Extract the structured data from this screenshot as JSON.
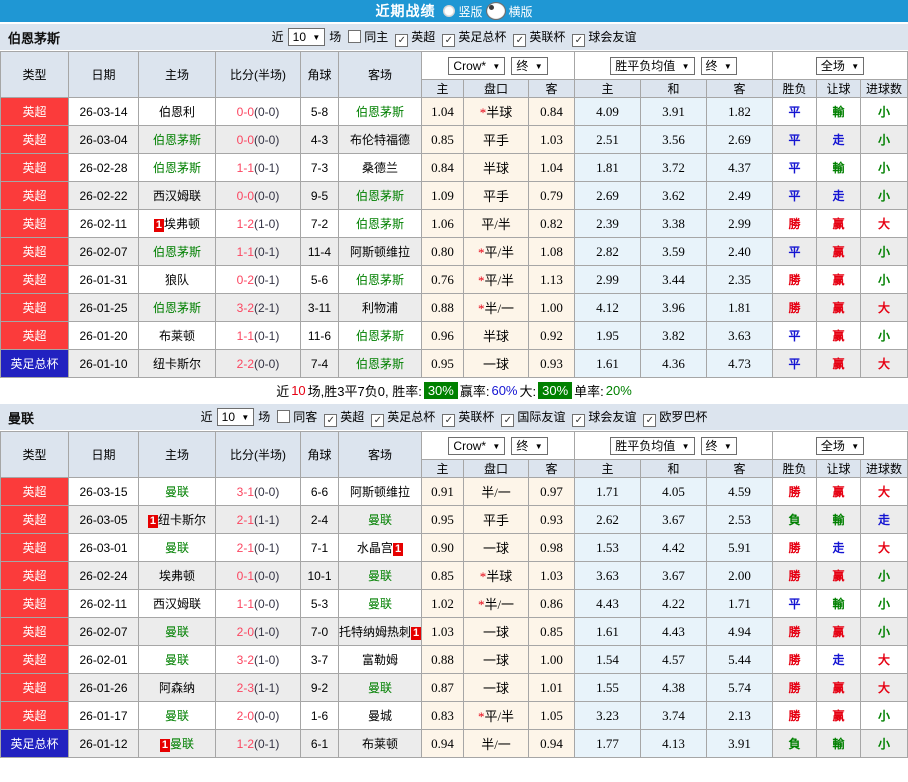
{
  "colors": {
    "topbar_blue": "#1f97d4",
    "header_gray": "#dce4ee",
    "league_red": "#fb3b3b",
    "cup_blue": "#2121c0",
    "win": "#e60012",
    "draw": "#1414d2",
    "lose": "#008000",
    "team_green": "#008000",
    "score_red": "#fb4560",
    "badge_red": "#e60000",
    "summary_box_green": "#008000",
    "crow_col_bg": "#fdf5e9",
    "avg_col_bg": "#e8f3fa"
  },
  "topbar": {
    "title": "近期战绩",
    "vertical_label": "竖版",
    "horizontal_label": "横版",
    "selected": "横版"
  },
  "table_header": {
    "main_cols": [
      "类型",
      "日期",
      "主场",
      "比分(半场)",
      "角球",
      "客场"
    ],
    "crow_select": "Crow*",
    "end_select_1": "终",
    "avg_select": "胜平负均值",
    "end_select_2": "终",
    "full_select": "全场",
    "sub_cols": [
      "主",
      "盘口",
      "客",
      "主",
      "和",
      "客",
      "胜负",
      "让球",
      "进球数"
    ]
  },
  "sections": [
    {
      "team": "伯恩茅斯",
      "filters": {
        "near": "近",
        "count": "10",
        "unit": "场",
        "same": "同主",
        "same_checked": false,
        "leagues": [
          "英超",
          "英足总杯",
          "英联杯",
          "球会友谊"
        ]
      },
      "rows": [
        {
          "league": "英超",
          "league_color": "red",
          "date": "26-03-14",
          "home": "伯恩利",
          "home_green": false,
          "home_badge": "",
          "score": "0-0",
          "half": "(0-0)",
          "corners": "5-8",
          "away": "伯恩茅斯",
          "away_green": true,
          "away_badge": "",
          "crow_home": "1.04",
          "handicap": "*半球",
          "crow_away": "0.84",
          "avg_home": "4.09",
          "avg_draw": "3.91",
          "avg_away": "1.82",
          "result": "平",
          "handicap_result": "輸",
          "goals_result": "小"
        },
        {
          "league": "英超",
          "league_color": "red",
          "date": "26-03-04",
          "home": "伯恩茅斯",
          "home_green": true,
          "home_badge": "",
          "score": "0-0",
          "half": "(0-0)",
          "corners": "4-3",
          "away": "布伦特福德",
          "away_green": false,
          "away_badge": "",
          "crow_home": "0.85",
          "handicap": "平手",
          "crow_away": "1.03",
          "avg_home": "2.51",
          "avg_draw": "3.56",
          "avg_away": "2.69",
          "result": "平",
          "handicap_result": "走",
          "goals_result": "小"
        },
        {
          "league": "英超",
          "league_color": "red",
          "date": "26-02-28",
          "home": "伯恩茅斯",
          "home_green": true,
          "home_badge": "",
          "score": "1-1",
          "half": "(0-1)",
          "corners": "7-3",
          "away": "桑德兰",
          "away_green": false,
          "away_badge": "",
          "crow_home": "0.84",
          "handicap": "半球",
          "crow_away": "1.04",
          "avg_home": "1.81",
          "avg_draw": "3.72",
          "avg_away": "4.37",
          "result": "平",
          "handicap_result": "輸",
          "goals_result": "小"
        },
        {
          "league": "英超",
          "league_color": "red",
          "date": "26-02-22",
          "home": "西汉姆联",
          "home_green": false,
          "home_badge": "",
          "score": "0-0",
          "half": "(0-0)",
          "corners": "9-5",
          "away": "伯恩茅斯",
          "away_green": true,
          "away_badge": "",
          "crow_home": "1.09",
          "handicap": "平手",
          "crow_away": "0.79",
          "avg_home": "2.69",
          "avg_draw": "3.62",
          "avg_away": "2.49",
          "result": "平",
          "handicap_result": "走",
          "goals_result": "小"
        },
        {
          "league": "英超",
          "league_color": "red",
          "date": "26-02-11",
          "home": "埃弗顿",
          "home_green": false,
          "home_badge": "1",
          "score": "1-2",
          "half": "(1-0)",
          "corners": "7-2",
          "away": "伯恩茅斯",
          "away_green": true,
          "away_badge": "",
          "crow_home": "1.06",
          "handicap": "平/半",
          "crow_away": "0.82",
          "avg_home": "2.39",
          "avg_draw": "3.38",
          "avg_away": "2.99",
          "result": "勝",
          "handicap_result": "赢",
          "goals_result": "大"
        },
        {
          "league": "英超",
          "league_color": "red",
          "date": "26-02-07",
          "home": "伯恩茅斯",
          "home_green": true,
          "home_badge": "",
          "score": "1-1",
          "half": "(0-1)",
          "corners": "11-4",
          "away": "阿斯顿维拉",
          "away_green": false,
          "away_badge": "",
          "crow_home": "0.80",
          "handicap": "*平/半",
          "crow_away": "1.08",
          "avg_home": "2.82",
          "avg_draw": "3.59",
          "avg_away": "2.40",
          "result": "平",
          "handicap_result": "赢",
          "goals_result": "小"
        },
        {
          "league": "英超",
          "league_color": "red",
          "date": "26-01-31",
          "home": "狼队",
          "home_green": false,
          "home_badge": "",
          "score": "0-2",
          "half": "(0-1)",
          "corners": "5-6",
          "away": "伯恩茅斯",
          "away_green": true,
          "away_badge": "",
          "crow_home": "0.76",
          "handicap": "*平/半",
          "crow_away": "1.13",
          "avg_home": "2.99",
          "avg_draw": "3.44",
          "avg_away": "2.35",
          "result": "勝",
          "handicap_result": "赢",
          "goals_result": "小"
        },
        {
          "league": "英超",
          "league_color": "red",
          "date": "26-01-25",
          "home": "伯恩茅斯",
          "home_green": true,
          "home_badge": "",
          "score": "3-2",
          "half": "(2-1)",
          "corners": "3-11",
          "away": "利物浦",
          "away_green": false,
          "away_badge": "",
          "crow_home": "0.88",
          "handicap": "*半/一",
          "crow_away": "1.00",
          "avg_home": "4.12",
          "avg_draw": "3.96",
          "avg_away": "1.81",
          "result": "勝",
          "handicap_result": "赢",
          "goals_result": "大"
        },
        {
          "league": "英超",
          "league_color": "red",
          "date": "26-01-20",
          "home": "布莱顿",
          "home_green": false,
          "home_badge": "",
          "score": "1-1",
          "half": "(0-1)",
          "corners": "11-6",
          "away": "伯恩茅斯",
          "away_green": true,
          "away_badge": "",
          "crow_home": "0.96",
          "handicap": "半球",
          "crow_away": "0.92",
          "avg_home": "1.95",
          "avg_draw": "3.82",
          "avg_away": "3.63",
          "result": "平",
          "handicap_result": "赢",
          "goals_result": "小"
        },
        {
          "league": "英足总杯",
          "league_color": "blue",
          "date": "26-01-10",
          "home": "纽卡斯尔",
          "home_green": false,
          "home_badge": "",
          "score": "2-2",
          "half": "(0-0)",
          "corners": "7-4",
          "away": "伯恩茅斯",
          "away_green": true,
          "away_badge": "",
          "crow_home": "0.95",
          "handicap": "一球",
          "crow_away": "0.93",
          "avg_home": "1.61",
          "avg_draw": "4.36",
          "avg_away": "4.73",
          "result": "平",
          "handicap_result": "赢",
          "goals_result": "大"
        }
      ],
      "summary": [
        {
          "t": "近"
        },
        {
          "t": "10",
          "c": "red"
        },
        {
          "t": "场,胜3平7负0, 胜率:"
        },
        {
          "t": "30%",
          "box": true
        },
        {
          "t": " 赢率:"
        },
        {
          "t": "60%",
          "c": "blue"
        },
        {
          "t": " 大:"
        },
        {
          "t": "30%",
          "box": true
        },
        {
          "t": " 单率:"
        },
        {
          "t": "20%",
          "c": "green"
        }
      ]
    },
    {
      "team": "曼联",
      "filters": {
        "near": "近",
        "count": "10",
        "unit": "场",
        "same": "同客",
        "same_checked": false,
        "leagues": [
          "英超",
          "英足总杯",
          "英联杯",
          "国际友谊",
          "球会友谊",
          "欧罗巴杯"
        ]
      },
      "rows": [
        {
          "league": "英超",
          "league_color": "red",
          "date": "26-03-15",
          "home": "曼联",
          "home_green": true,
          "home_badge": "",
          "score": "3-1",
          "half": "(0-0)",
          "corners": "6-6",
          "away": "阿斯顿维拉",
          "away_green": false,
          "away_badge": "",
          "crow_home": "0.91",
          "handicap": "半/一",
          "crow_away": "0.97",
          "avg_home": "1.71",
          "avg_draw": "4.05",
          "avg_away": "4.59",
          "result": "勝",
          "handicap_result": "赢",
          "goals_result": "大"
        },
        {
          "league": "英超",
          "league_color": "red",
          "date": "26-03-05",
          "home": "纽卡斯尔",
          "home_green": false,
          "home_badge": "1",
          "score": "2-1",
          "half": "(1-1)",
          "corners": "2-4",
          "away": "曼联",
          "away_green": true,
          "away_badge": "",
          "crow_home": "0.95",
          "handicap": "平手",
          "crow_away": "0.93",
          "avg_home": "2.62",
          "avg_draw": "3.67",
          "avg_away": "2.53",
          "result": "負",
          "handicap_result": "輸",
          "goals_result": "走"
        },
        {
          "league": "英超",
          "league_color": "red",
          "date": "26-03-01",
          "home": "曼联",
          "home_green": true,
          "home_badge": "",
          "score": "2-1",
          "half": "(0-1)",
          "corners": "7-1",
          "away": "水晶宫",
          "away_green": false,
          "away_badge": "1",
          "crow_home": "0.90",
          "handicap": "一球",
          "crow_away": "0.98",
          "avg_home": "1.53",
          "avg_draw": "4.42",
          "avg_away": "5.91",
          "result": "勝",
          "handicap_result": "走",
          "goals_result": "大"
        },
        {
          "league": "英超",
          "league_color": "red",
          "date": "26-02-24",
          "home": "埃弗顿",
          "home_green": false,
          "home_badge": "",
          "score": "0-1",
          "half": "(0-0)",
          "corners": "10-1",
          "away": "曼联",
          "away_green": true,
          "away_badge": "",
          "crow_home": "0.85",
          "handicap": "*半球",
          "crow_away": "1.03",
          "avg_home": "3.63",
          "avg_draw": "3.67",
          "avg_away": "2.00",
          "result": "勝",
          "handicap_result": "赢",
          "goals_result": "小"
        },
        {
          "league": "英超",
          "league_color": "red",
          "date": "26-02-11",
          "home": "西汉姆联",
          "home_green": false,
          "home_badge": "",
          "score": "1-1",
          "half": "(0-0)",
          "corners": "5-3",
          "away": "曼联",
          "away_green": true,
          "away_badge": "",
          "crow_home": "1.02",
          "handicap": "*半/一",
          "crow_away": "0.86",
          "avg_home": "4.43",
          "avg_draw": "4.22",
          "avg_away": "1.71",
          "result": "平",
          "handicap_result": "輸",
          "goals_result": "小"
        },
        {
          "league": "英超",
          "league_color": "red",
          "date": "26-02-07",
          "home": "曼联",
          "home_green": true,
          "home_badge": "",
          "score": "2-0",
          "half": "(1-0)",
          "corners": "7-0",
          "away": "托特纳姆热刺",
          "away_green": false,
          "away_badge": "1",
          "crow_home": "1.03",
          "handicap": "一球",
          "crow_away": "0.85",
          "avg_home": "1.61",
          "avg_draw": "4.43",
          "avg_away": "4.94",
          "result": "勝",
          "handicap_result": "赢",
          "goals_result": "小"
        },
        {
          "league": "英超",
          "league_color": "red",
          "date": "26-02-01",
          "home": "曼联",
          "home_green": true,
          "home_badge": "",
          "score": "3-2",
          "half": "(1-0)",
          "corners": "3-7",
          "away": "富勒姆",
          "away_green": false,
          "away_badge": "",
          "crow_home": "0.88",
          "handicap": "一球",
          "crow_away": "1.00",
          "avg_home": "1.54",
          "avg_draw": "4.57",
          "avg_away": "5.44",
          "result": "勝",
          "handicap_result": "走",
          "goals_result": "大"
        },
        {
          "league": "英超",
          "league_color": "red",
          "date": "26-01-26",
          "home": "阿森纳",
          "home_green": false,
          "home_badge": "",
          "score": "2-3",
          "half": "(1-1)",
          "corners": "9-2",
          "away": "曼联",
          "away_green": true,
          "away_badge": "",
          "crow_home": "0.87",
          "handicap": "一球",
          "crow_away": "1.01",
          "avg_home": "1.55",
          "avg_draw": "4.38",
          "avg_away": "5.74",
          "result": "勝",
          "handicap_result": "赢",
          "goals_result": "大"
        },
        {
          "league": "英超",
          "league_color": "red",
          "date": "26-01-17",
          "home": "曼联",
          "home_green": true,
          "home_badge": "",
          "score": "2-0",
          "half": "(0-0)",
          "corners": "1-6",
          "away": "曼城",
          "away_green": false,
          "away_badge": "",
          "crow_home": "0.83",
          "handicap": "*平/半",
          "crow_away": "1.05",
          "avg_home": "3.23",
          "avg_draw": "3.74",
          "avg_away": "2.13",
          "result": "勝",
          "handicap_result": "赢",
          "goals_result": "小"
        },
        {
          "league": "英足总杯",
          "league_color": "blue",
          "date": "26-01-12",
          "home": "曼联",
          "home_green": true,
          "home_badge": "1",
          "score": "1-2",
          "half": "(0-1)",
          "corners": "6-1",
          "away": "布莱顿",
          "away_green": false,
          "away_badge": "",
          "crow_home": "0.94",
          "handicap": "半/一",
          "crow_away": "0.94",
          "avg_home": "1.77",
          "avg_draw": "4.13",
          "avg_away": "3.91",
          "result": "負",
          "handicap_result": "輸",
          "goals_result": "小"
        }
      ],
      "summary": []
    }
  ]
}
